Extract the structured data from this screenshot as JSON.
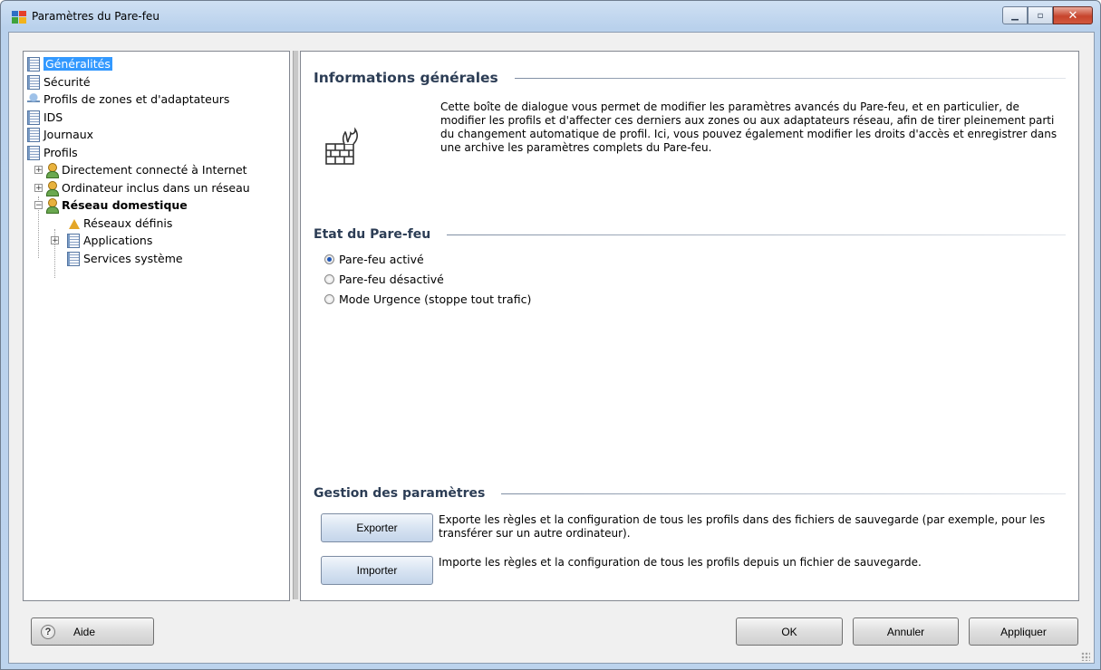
{
  "window": {
    "title": "Paramètres du Pare-feu",
    "minimize_glyph": "▁",
    "maximize_glyph": "▫",
    "close_glyph": "✕"
  },
  "tree": {
    "items": [
      {
        "label": "Généralités",
        "icon": "document-icon",
        "selected": true
      },
      {
        "label": "Sécurité",
        "icon": "document-icon"
      },
      {
        "label": "Profils de zones et d'adaptateurs",
        "icon": "network-icon"
      },
      {
        "label": "IDS",
        "icon": "document-icon"
      },
      {
        "label": "Journaux",
        "icon": "document-icon"
      },
      {
        "label": "Profils",
        "icon": "document-icon"
      },
      {
        "label": "Directement connecté à Internet",
        "icon": "user-icon",
        "expander": "+"
      },
      {
        "label": "Ordinateur inclus dans un réseau",
        "icon": "user-icon",
        "expander": "+"
      },
      {
        "label": "Réseau domestique",
        "icon": "user-icon",
        "expander": "−",
        "bold": true
      },
      {
        "label": "Réseaux définis",
        "icon": "network-warning-icon"
      },
      {
        "label": "Applications",
        "icon": "document-icon",
        "expander": "+"
      },
      {
        "label": "Services système",
        "icon": "document-icon"
      }
    ]
  },
  "general_info": {
    "heading": "Informations générales",
    "text": "Cette boîte de dialogue vous permet de modifier les paramètres avancés du Pare-feu, et en particulier, de modifier les profils et d'affecter ces derniers aux zones ou aux adaptateurs réseau, afin de tirer pleinement parti du changement automatique de profil. Ici, vous pouvez également modifier les droits d'accès et enregistrer dans une archive les paramètres complets du Pare-feu."
  },
  "firewall_state": {
    "heading": "Etat du Pare-feu",
    "options": [
      {
        "label": "Pare-feu activé",
        "checked": true
      },
      {
        "label": "Pare-feu désactivé",
        "checked": false
      },
      {
        "label": "Mode Urgence (stoppe tout trafic)",
        "checked": false
      }
    ]
  },
  "settings_management": {
    "heading": "Gestion des paramètres",
    "export_label": "Exporter",
    "export_desc": "Exporte les règles et la configuration de tous les profils dans des fichiers de sauvegarde (par exemple, pour les transférer sur un autre ordinateur).",
    "import_label": "Importer",
    "import_desc": "Importe les règles et la configuration de tous les profils depuis un fichier de sauvegarde."
  },
  "footer": {
    "help_label": "Aide",
    "help_glyph": "?",
    "ok_label": "OK",
    "cancel_label": "Annuler",
    "apply_label": "Appliquer"
  }
}
